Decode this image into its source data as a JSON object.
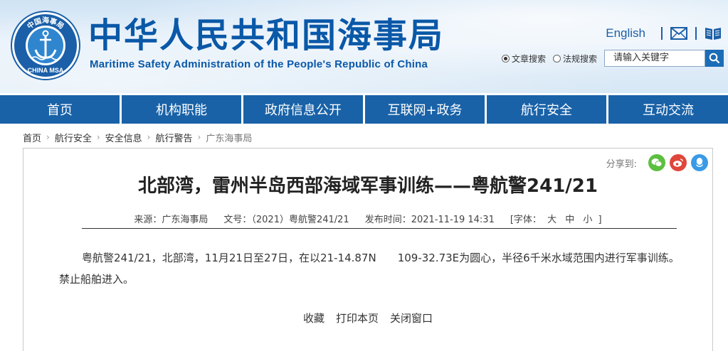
{
  "header": {
    "logo": {
      "top_text": "中国海事局",
      "bottom_text": "CHINA MSA"
    },
    "title_cn": "中华人民共和国海事局",
    "title_en": "Maritime Safety Administration of the People's Republic of China",
    "english_link": "English",
    "icons": [
      "mail-icon",
      "book-icon"
    ],
    "search": {
      "options": [
        {
          "label": "文章搜索",
          "selected": true
        },
        {
          "label": "法规搜索",
          "selected": false
        }
      ],
      "placeholder": "请输入关键字"
    }
  },
  "nav": [
    "首页",
    "机构职能",
    "政府信息公开",
    "互联网+政务",
    "航行安全",
    "互动交流"
  ],
  "breadcrumb": [
    "首页",
    "航行安全",
    "安全信息",
    "航行警告",
    "广东海事局"
  ],
  "article": {
    "share_label": "分享到:",
    "share_icons": [
      "wechat-icon",
      "weibo-icon",
      "qq-icon"
    ],
    "title": "北部湾，雷州半岛西部海域军事训练——粤航警241/21",
    "meta": {
      "source": "来源：广东海事局",
      "doc_no": "文号：（2021）粤航警241/21",
      "publish_time": "发布时间：2021-11-19 14:31",
      "font_size_label": "[字体：",
      "font_size_options": [
        "大",
        "中",
        "小"
      ],
      "font_size_end": "]"
    },
    "body": "粤航警241/21，北部湾，11月21日至27日，在以21-14.87N　　109-32.73E为圆心，半径6千米水域范围内进行军事训练。禁止船舶进入。",
    "actions": [
      "收藏",
      "打印本页",
      "关闭窗口"
    ]
  },
  "colors": {
    "nav_bg": "#1962a8",
    "title_blue": "#0a58a8",
    "wechat": "#5cbf3f",
    "weibo": "#e0463b",
    "qq": "#3a9ae6"
  }
}
